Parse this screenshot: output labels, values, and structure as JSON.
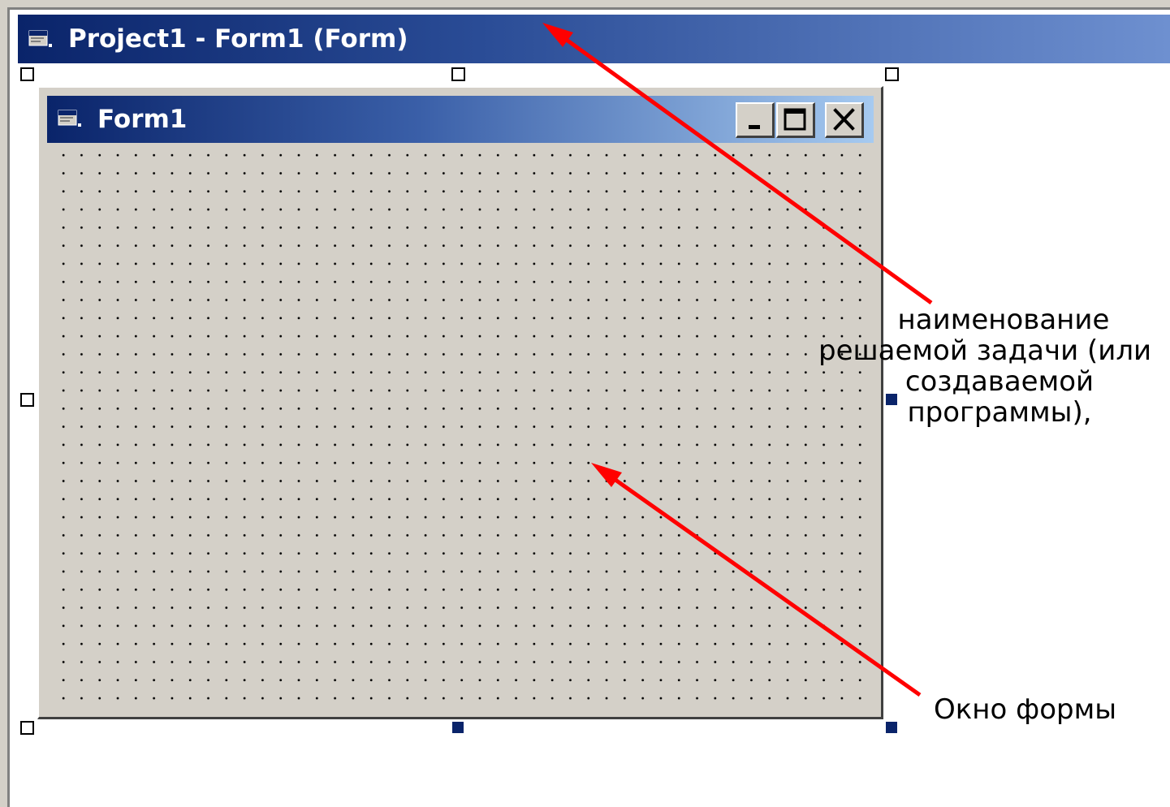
{
  "designer_window": {
    "title": "Project1 - Form1 (Form)",
    "icon": "form-icon"
  },
  "form_window": {
    "title": "Form1",
    "icon": "form-icon",
    "buttons": {
      "minimize": "minimize-icon",
      "maximize": "maximize-icon",
      "close": "close-icon"
    }
  },
  "annotations": {
    "project_name": {
      "lines": [
        "наименование",
        "решаемой задачи (или",
        "создаваемой",
        "программы),"
      ]
    },
    "form_window_label": "Окно формы"
  },
  "colors": {
    "titlebar_active": "#0a246a",
    "titlebar_gradient_end": "#a6caf0",
    "button_face": "#d4d0c8",
    "arrow": "#ff0000"
  }
}
